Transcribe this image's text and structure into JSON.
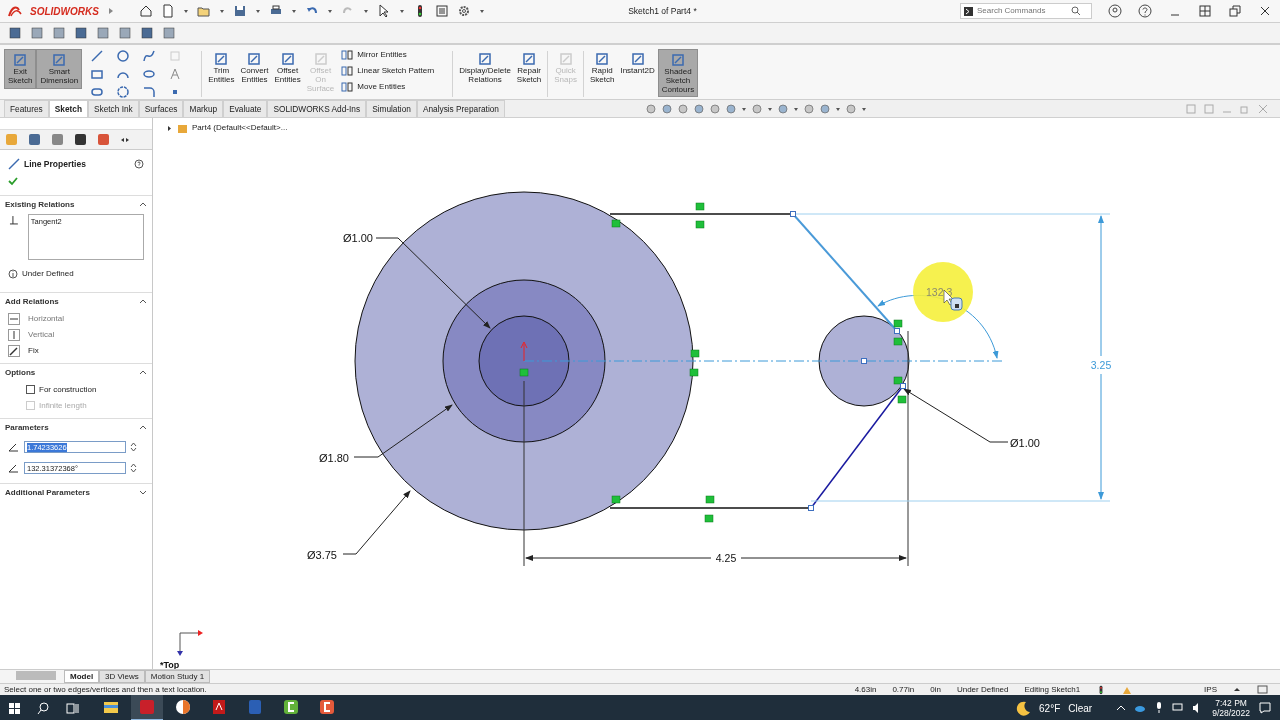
{
  "title_bar": {
    "app_name": "SOLIDWORKS",
    "document_title": "Sketch1 of Part4 *",
    "search_placeholder": "Search Commands"
  },
  "ribbon": {
    "left_buttons": [
      {
        "label": "Exit Sketch",
        "selected": true,
        "disabled": false
      },
      {
        "label": "Smart Dimension",
        "selected": true,
        "disabled": false
      },
      {
        "label": "Trim Entities",
        "selected": false,
        "disabled": false
      },
      {
        "label": "Convert Entities",
        "selected": false,
        "disabled": false
      },
      {
        "label": "Offset Entities",
        "selected": false,
        "disabled": false
      },
      {
        "label": "Offset On Surface",
        "selected": false,
        "disabled": true
      }
    ],
    "list_commands": [
      "Mirror Entities",
      "Linear Sketch Pattern",
      "Move Entities"
    ],
    "right_buttons": [
      {
        "label": "Display/Delete Relations",
        "selected": false,
        "disabled": false
      },
      {
        "label": "Repair Sketch",
        "selected": false,
        "disabled": false
      },
      {
        "label": "Quick Snaps",
        "selected": false,
        "disabled": true
      },
      {
        "label": "Rapid Sketch",
        "selected": false,
        "disabled": false
      },
      {
        "label": "Instant2D",
        "selected": false,
        "disabled": false
      },
      {
        "label": "Shaded Sketch Contours",
        "selected": true,
        "disabled": false
      }
    ]
  },
  "tabs": [
    {
      "label": "Features",
      "selected": false
    },
    {
      "label": "Sketch",
      "selected": true
    },
    {
      "label": "Sketch Ink",
      "selected": false
    },
    {
      "label": "Surfaces",
      "selected": false
    },
    {
      "label": "Markup",
      "selected": false
    },
    {
      "label": "Evaluate",
      "selected": false
    },
    {
      "label": "SOLIDWORKS Add-Ins",
      "selected": false
    },
    {
      "label": "Simulation",
      "selected": false
    },
    {
      "label": "Analysis Preparation",
      "selected": false
    }
  ],
  "tree_path": "Part4  (Default<<Default>...",
  "property_manager": {
    "title": "Line Properties",
    "sections": [
      {
        "kind": "relations",
        "heading": "Existing Relations",
        "expanded": true,
        "items": [
          "Tangent2"
        ],
        "status": "Under Defined"
      },
      {
        "kind": "add",
        "heading": "Add Relations",
        "expanded": true,
        "items": [
          {
            "label": "Horizontal",
            "disabled": true
          },
          {
            "label": "Vertical",
            "disabled": true
          },
          {
            "label": "Fix",
            "disabled": false
          }
        ]
      },
      {
        "kind": "options",
        "heading": "Options",
        "expanded": true,
        "checkboxes": [
          {
            "label": "For construction",
            "checked": false,
            "disabled": false
          },
          {
            "label": "Infinite length",
            "checked": false,
            "disabled": true
          }
        ]
      },
      {
        "kind": "parameters",
        "heading": "Parameters",
        "expanded": true,
        "fields": [
          {
            "value": "1.74233626",
            "selected": true
          },
          {
            "value": "132.31372368°",
            "selected": false
          }
        ]
      },
      {
        "heading": "Additional Parameters",
        "expanded": false
      }
    ]
  },
  "sketch": {
    "diameters": [
      "Ø1.00",
      "Ø1.80",
      "Ø3.75",
      "Ø1.00"
    ],
    "linear_dimensions": [
      "4.25",
      "3.25"
    ],
    "angle_dimension": "132.3",
    "view_label": "*Top"
  },
  "bottom_tabs": [
    {
      "label": "Model",
      "selected": true
    },
    {
      "label": "3D Views",
      "selected": false
    },
    {
      "label": "Motion Study 1",
      "selected": false
    }
  ],
  "status_bar": {
    "message": "Select one or two edges/vertices and then a text location.",
    "readouts": [
      "4.63in",
      "0.77in",
      "0in",
      "Under Defined",
      "Editing Sketch1"
    ],
    "units": "IPS"
  },
  "taskbar": {
    "apps": [
      {
        "kind": "folder",
        "active": false
      },
      {
        "kind": "cad",
        "active": true
      },
      {
        "kind": "browser",
        "active": false
      },
      {
        "kind": "pdf",
        "active": false
      },
      {
        "kind": "word",
        "active": false
      },
      {
        "kind": "green",
        "active": false
      },
      {
        "kind": "orange",
        "active": false
      }
    ],
    "weather": {
      "temperature": "62°F",
      "condition": "Clear"
    },
    "time": "7:42 PM",
    "date": "9/28/2022"
  }
}
